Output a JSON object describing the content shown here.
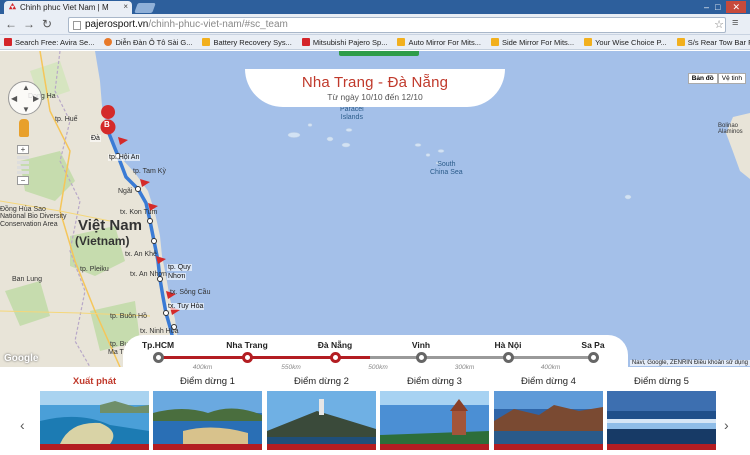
{
  "browser": {
    "tab_title": "Chinh phuc Viet Nam | M",
    "url_host": "pajerosport.vn",
    "url_path": "/chinh-phuc-viet-nam/#sc_team",
    "window_buttons": [
      "–",
      "□",
      "✕"
    ]
  },
  "bookmarks": [
    {
      "label": "Search Free: Avira Se...",
      "icon": "avira-icon",
      "color": "#d4252a"
    },
    {
      "label": "Diễn Đàn Ô Tô Sài G...",
      "icon": "forum-icon",
      "color": "#e87a2a"
    },
    {
      "label": "Battery Recovery Sys...",
      "icon": "ad-icon",
      "color": "#f2b01e"
    },
    {
      "label": "Mitsubishi Pajero Sp...",
      "icon": "mitsubishi-icon",
      "color": "#d4252a"
    },
    {
      "label": "Auto Mirror For Mits...",
      "icon": "ad-icon",
      "color": "#f2b01e"
    },
    {
      "label": "Side Mirror For Mits...",
      "icon": "ad-icon",
      "color": "#f2b01e"
    },
    {
      "label": "Your Wise Choice P...",
      "icon": "ad-icon",
      "color": "#f2b01e"
    },
    {
      "label": "S/s Rear Tow Bar For...",
      "icon": "ad-icon",
      "color": "#f2b01e"
    }
  ],
  "header": {
    "title": "Nha Trang - Đà Nẵng",
    "subtitle": "Từ ngày 10/10 đến 12/10"
  },
  "map": {
    "map_type_buttons": [
      "Bản đồ",
      "Vệ tinh"
    ],
    "country_label": "Việt Nam",
    "country_label_2": "(Vietnam)",
    "sea_label": "South\nChina Sea",
    "paracel_label": "Paracel\nIslands",
    "islands_right": "Bolinao\nAlaminos",
    "route_end_marker": "B",
    "labels": [
      {
        "text": "Dong Ha",
        "cls": ""
      },
      {
        "text": "tp. Huế",
        "cls": ""
      },
      {
        "text": "Đà",
        "cls": "city"
      },
      {
        "text": "tp. Hội An",
        "cls": "city"
      },
      {
        "text": "tp. Tam Kỳ",
        "cls": ""
      },
      {
        "text": "Ngãi",
        "cls": ""
      },
      {
        "text": "Đồng Hủa Sao",
        "cls": ""
      },
      {
        "text": "National Bio Diversity",
        "cls": ""
      },
      {
        "text": "Conservation Area",
        "cls": ""
      },
      {
        "text": "tx. Kon Tum",
        "cls": ""
      },
      {
        "text": "tp. Pleiku",
        "cls": ""
      },
      {
        "text": "tx. An Khê",
        "cls": ""
      },
      {
        "text": "tx. An Nhơn",
        "cls": ""
      },
      {
        "text": "tp. Quy",
        "cls": "city"
      },
      {
        "text": "Nhơn",
        "cls": "city"
      },
      {
        "text": "tx. Sông Cầu",
        "cls": ""
      },
      {
        "text": "tx. Tuy Hòa",
        "cls": "city"
      },
      {
        "text": "tp. Buôn Hồ",
        "cls": ""
      },
      {
        "text": "tp. Buôn",
        "cls": ""
      },
      {
        "text": "Ma Thuột",
        "cls": ""
      },
      {
        "text": "Ban Lung",
        "cls": ""
      },
      {
        "text": "tx. Ninh Hòa",
        "cls": ""
      }
    ],
    "google_logo": "Google",
    "attribution": "Navi, Google, ZENRIN   Điều khoản sử dụng"
  },
  "timeline": {
    "stops": [
      "Tp.HCM",
      "Nha Trang",
      "Đà Nẵng",
      "Vinh",
      "Hà Nội",
      "Sa Pa"
    ],
    "distances": [
      "400km",
      "550km",
      "500km",
      "300km",
      "400km"
    ],
    "active_color": "#b31d22"
  },
  "cards": [
    {
      "title": "Xuất phát"
    },
    {
      "title": "Điểm dừng 1"
    },
    {
      "title": "Điểm dừng 2"
    },
    {
      "title": "Điểm dừng 3"
    },
    {
      "title": "Điểm dừng 4"
    },
    {
      "title": "Điểm dừng 5"
    }
  ],
  "nav": {
    "prev": "‹",
    "next": "›"
  }
}
